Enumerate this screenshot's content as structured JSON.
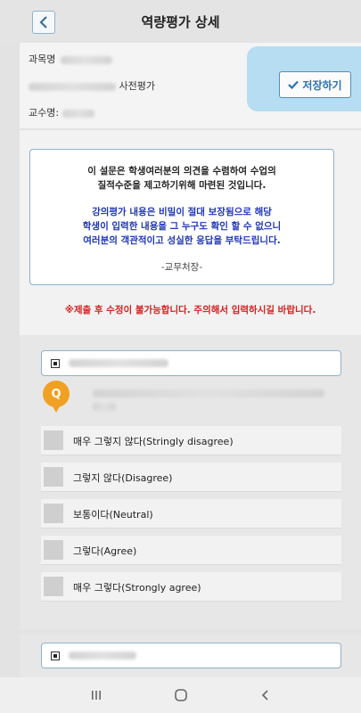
{
  "header": {
    "title": "역량평가 상세"
  },
  "info": {
    "subject_label": "과목명",
    "pretest_label": "사전평가",
    "professor_label": "교수명:"
  },
  "save_button": {
    "label": "저장하기"
  },
  "notice": {
    "line1": "이 설문은 학생여러분의 의견을 수렴하여 수업의",
    "line2": "질적수준을 제고하기위해 마련된 것입니다.",
    "blue1": "강의평가 내용은 비밀이 절대 보장됨으로 해당",
    "blue2": "학생이 입력한 내용을 그 누구도 확인 할 수 없으니",
    "blue3": "여러분의 객관적이고 성실한 응답을 부탁드립니다.",
    "signature": "-교무처장-"
  },
  "warning": "※제출 후 수정이 불가능합니다. 주의해서 입력하시길 바랍니다.",
  "question": {
    "badge": "Q",
    "options": [
      "매우 그렇지 않다(Stringly disagree)",
      "그렇지 않다(Disagree)",
      "보통이다(Neutral)",
      "그렇다(Agree)",
      "매우 그렇다(Strongly agree)"
    ]
  },
  "colors": {
    "accent": "#2b71b8",
    "warning": "#d62020",
    "notice_blue": "#1e35b8",
    "badge": "#f0a023"
  }
}
